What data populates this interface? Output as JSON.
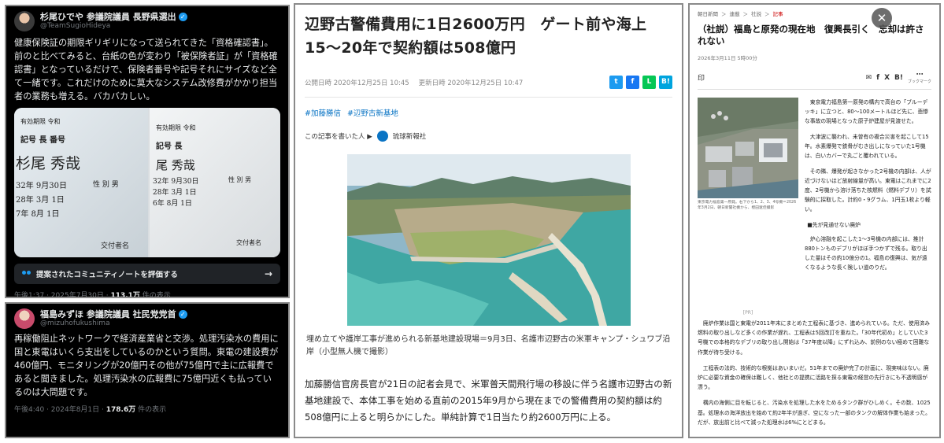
{
  "tweet1": {
    "name": "杉尾ひでや 参議院議員 長野県選出",
    "handle": "@TeamSugioHideya",
    "body": "健康保険証の期限ギリギリになって送られてきた「資格確認書」。前のと比べてみると、台紙の色が変わり「被保険者証」が「資格確認書」となっているだけで、保険者番号や記号それにサイズなど全て一緒です。これだけのために莫大なシステム改修費がかかり担当者の業務も増える。バカバカしい。",
    "image_text": {
      "valid_a": "有効期限 令和",
      "valid_b": "有効期限 令和",
      "kigo_a": "記号 長  番号",
      "kigo_b": "記号 長",
      "name_a": "杉尾 秀哉",
      "name_b": "尾 秀哉",
      "dob_a": "32年 9月30日",
      "dob_b": "32年 9月30日",
      "date2_a": "28年 3月 1日",
      "date2_b": "28年 3月 1日",
      "date3_a": "7年 8月 1日",
      "date3_b": "6年 8月 1日",
      "sex_a": "性 別 男",
      "sex_b": "性 別 男",
      "issuer_a": "交付者名",
      "issuer_b": "交付者名"
    },
    "note_label": "提案されたコミュニティノートを評価する",
    "time": "午後1:37 · 2025年7月30日 · ",
    "views": "113.1万",
    "views_suffix": " 件の表示"
  },
  "tweet2": {
    "name": "福島みずほ 参議院議員 社民党党首",
    "handle": "@mizuhofukushima",
    "body": "再稼働阻止ネットワークで経済産業省と交渉。処理汚染水の費用に国と東電はいくら支出をしているのかという質問。東電の建設費が460億円、モニタリングが20億円その他が75億円で主に広報費であると聞きました。処理汚染水の広報費に75億円近くも払っているのは大問題です。",
    "time": "午後4:40 · 2024年8月1日 · ",
    "views": "178.6万",
    "views_suffix": " 件の表示"
  },
  "article": {
    "title": "辺野古警備費用に1日2600万円　ゲート前や海上　15〜20年で契約額は508億円",
    "published": "公開日時 2020年12月25日 10:45",
    "updated": "更新日時 2020年12月25日 10:47",
    "share": [
      "t",
      "f",
      "L",
      "B!"
    ],
    "tags": [
      "#加藤勝信",
      "#辺野古新基地"
    ],
    "author_label": "この記事を書いた人 ▶",
    "publisher": "琉球新報社",
    "caption": "埋め立てや護岸工事が進められる新基地建設現場＝9月3日、名護市辺野古の米軍キャンプ・シュワブ沿岸（小型無人機で撮影）",
    "body": "加藤勝信官房長官が21日の記者会見で、米軍普天間飛行場の移設に伴う名護市辺野古の新基地建設で、本体工事を始める直前の2015年9月から現在までの警備費用の契約額は約508億円に上ると明らかにした。単純計算で1日当たり約2600万円に上る。"
  },
  "editorial": {
    "crumbs": [
      "朝日新聞",
      "＞",
      "連載",
      "＞",
      "社説",
      "＞",
      "記事"
    ],
    "title": "（社説）福島と原発の現在地　復興長引く　忘却は許されない",
    "date": "2026年3月11日 5時00分",
    "print": "印",
    "icons": [
      "✉",
      "f",
      "X",
      "B!",
      "⋯"
    ],
    "icon_labels": [
      "",
      "",
      "",
      "",
      "ブックマーク"
    ],
    "photo_caption": "東京電力福島第一原発。右下から1、2、3、4号機＝2026年3月2日、朝日新聞社機から、樫田遼佳撮影",
    "pr": "[PR]",
    "side_paragraphs": [
      "東京電力福島第一原発の構内で高台の「ブルーデッキ」に立つと、80〜100メートルほど先に、悲惨な事故の現場となった原子炉建屋が見渡せた。",
      "大津波に襲われ、未曽有の複合災害を起こして15年。水素爆発で鉄骨がむき出しになっていた1号機は、白いカバーで丸ごと覆われている。",
      "その隣、爆発が起きなかった2号機の内部は、人が近づけないほど放射線量が高い。東電はこれまでに2度、2号機から溶け落ちた核燃料（燃料デブリ）を試験的に採取した。計約0・9グラム、1円玉1枚より軽い。"
    ],
    "subhead": "■先が見通せない廃炉",
    "side_paragraph_last": "炉心溶融を起こした1〜3号機の内部には、推計880トンものデブリがほぼ手つかずで残る。取り出した量はその約10億分の1。福島の復興は、気が遠くなるような長く険しい道のりだ。",
    "full_paragraphs": [
      "廃炉作業は国と東電が2011年末にまとめた工程表に基づき、進められている。ただ、使用済み燃料の取り出しなど多くの作業が遅れ、工程表は5回改訂を重ねた。「30年代初め」としていた3号機での本格的なデブリの取り出し開始は「37年度以降」にずれ込み、前例のない極めて困難な作業が待ち受ける。",
      "工程表の法的、技術的な根拠はあいまいだ。51年までの廃炉完了の計画に、現実味はない。廃炉に必要な資金の確保は難しく、他社との提携に活路を探る東電の経営の先行きにも不透明感が漂う。",
      "構内の海側に目を転じると、汚染水を処理した水をためるタンク群がひしめく。その数、1025基。処理水の海洋放出を始めて約2年半が過ぎ、空になった一部のタンクの解体作業も始まった。だが、放出前と比べて減った処理水は6%にとどまる。"
    ]
  }
}
